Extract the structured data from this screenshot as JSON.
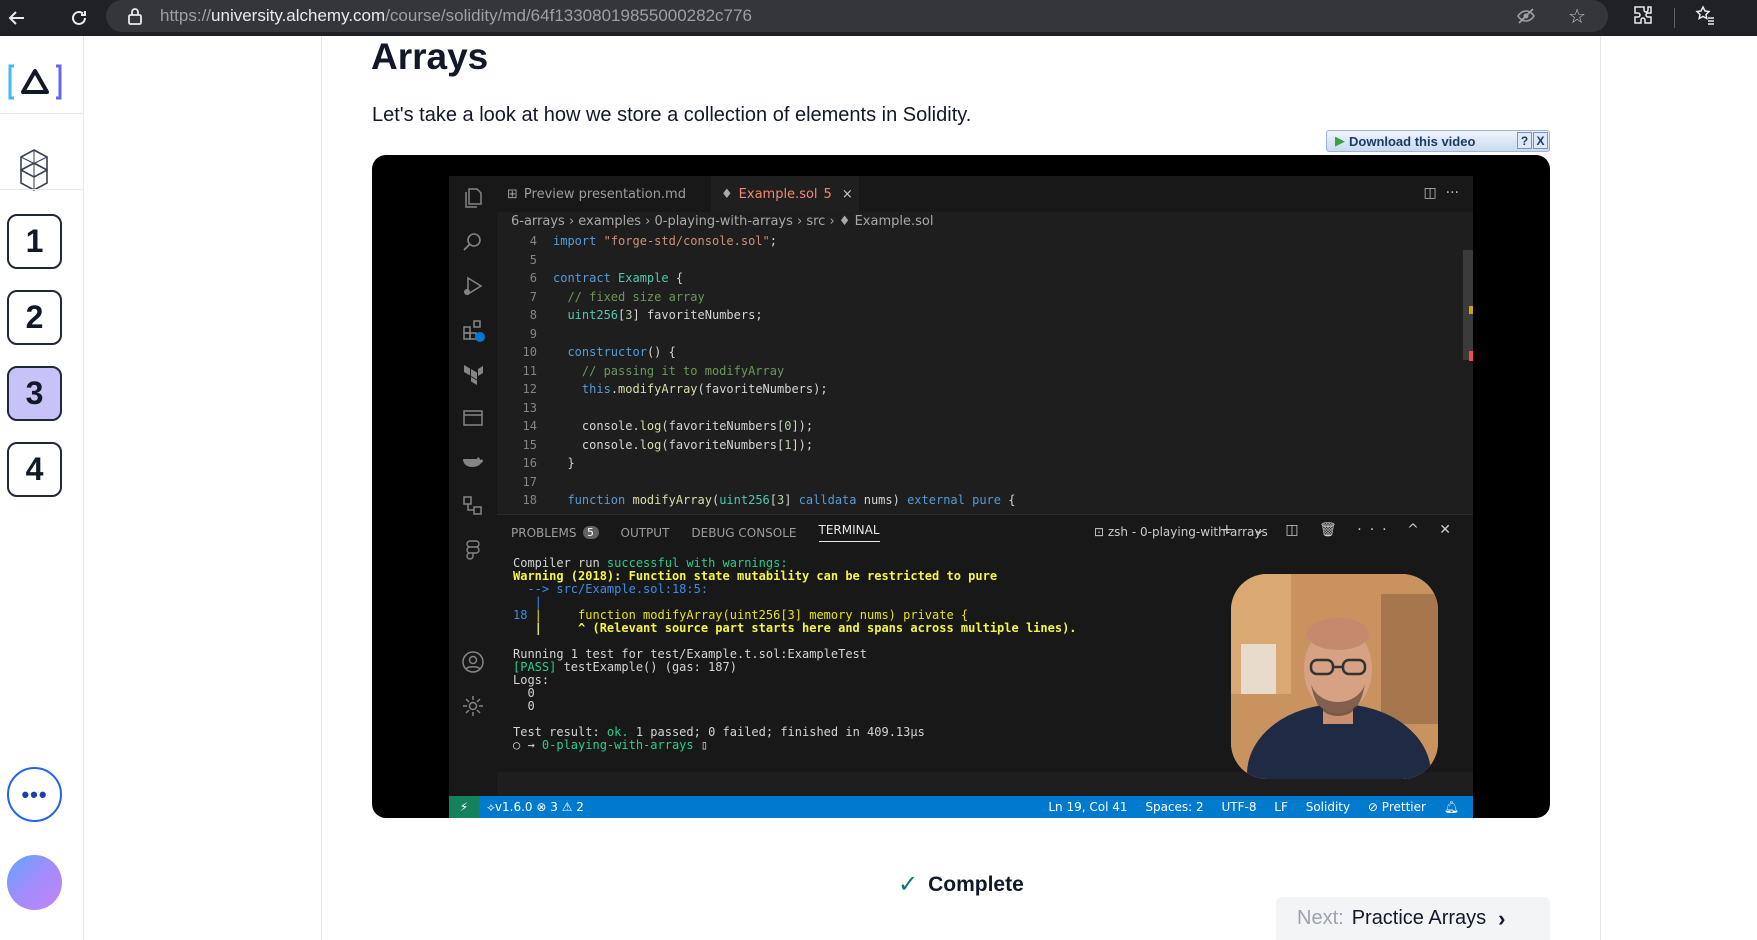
{
  "browser": {
    "url_prefix": "https://",
    "url_host": "university.alchemy.com",
    "url_path": "/course/solidity/md/64f13308019855000282c776"
  },
  "rail": {
    "logo_label": "[A]",
    "steps": [
      "1",
      "2",
      "3",
      "4"
    ],
    "active_step": "3",
    "more_label": "•••"
  },
  "lesson": {
    "title": "Arrays",
    "intro": "Let's take a look at how we store a collection of elements in Solidity."
  },
  "downloader": {
    "label": "Download this video",
    "help": "?",
    "close": "X"
  },
  "video": {
    "tabs": {
      "preview": "Preview presentation.md",
      "active": "Example.sol",
      "active_count": "5",
      "close": "×"
    },
    "breadcrumb": "6-arrays › examples › 0-playing-with-arrays › src › ♦ Example.sol",
    "code_lines": [
      {
        "n": "4",
        "t": "import \"forge-std/console.sol\";"
      },
      {
        "n": "5",
        "t": ""
      },
      {
        "n": "6",
        "t": "contract Example {"
      },
      {
        "n": "7",
        "t": "  // fixed size array"
      },
      {
        "n": "8",
        "t": "  uint256[3] favoriteNumbers;"
      },
      {
        "n": "9",
        "t": ""
      },
      {
        "n": "10",
        "t": "  constructor() {"
      },
      {
        "n": "11",
        "t": "    // passing it to modifyArray"
      },
      {
        "n": "12",
        "t": "    this.modifyArray(favoriteNumbers);"
      },
      {
        "n": "13",
        "t": ""
      },
      {
        "n": "14",
        "t": "    console.log(favoriteNumbers[0]);"
      },
      {
        "n": "15",
        "t": "    console.log(favoriteNumbers[1]);"
      },
      {
        "n": "16",
        "t": "  }"
      },
      {
        "n": "17",
        "t": ""
      },
      {
        "n": "18",
        "t": "  function modifyArray(uint256[3] calldata nums) external pure {"
      }
    ],
    "panel_tabs": [
      "PROBLEMS",
      "OUTPUT",
      "DEBUG CONSOLE",
      "TERMINAL"
    ],
    "problems_count": "5",
    "terminal_title": "zsh - 0-playing-with-arrays",
    "terminal_controls": "+ ⌄ ◫ 🗑 ··· ^ ✕",
    "terminal": {
      "l1a": "Compiler run ",
      "l1b": "successful with warnings:",
      "l2": "Warning (2018): Function state mutability can be restricted to pure",
      "l3": "  --> src/Example.sol:18:5:",
      "l4": "   |",
      "l5n": "18",
      "l5": " |     function modifyArray(uint256[3] memory nums) private {",
      "l6": "   |     ^ (Relevant source part starts here and spans across multiple lines).",
      "l7": "Running 1 test for test/Example.t.sol:ExampleTest",
      "l8a": "[PASS]",
      "l8b": " testExample() (gas: 187)",
      "l9": "Logs:",
      "l10": "  0",
      "l11": "  0",
      "l12a": "Test result: ",
      "l12b": "ok.",
      "l12c": " 1 passed; 0 failed; finished in 409.13µs",
      "l13a": "○ → ",
      "l13b": "0-playing-with-arrays",
      "l13c": " ▯"
    },
    "status_left": "⟡v1.6.0  ⊗ 3 ⚠ 2",
    "status_right": [
      "Ln 19, Col 41",
      "Spaces: 2",
      "UTF-8",
      "LF",
      "Solidity",
      "⊘ Prettier"
    ]
  },
  "footer": {
    "complete_label": "Complete",
    "next_prefix": "Next:",
    "next_title": "Practice Arrays"
  },
  "colors": {
    "accent": "#c7c2f7",
    "vscode_status": "#007acc"
  }
}
